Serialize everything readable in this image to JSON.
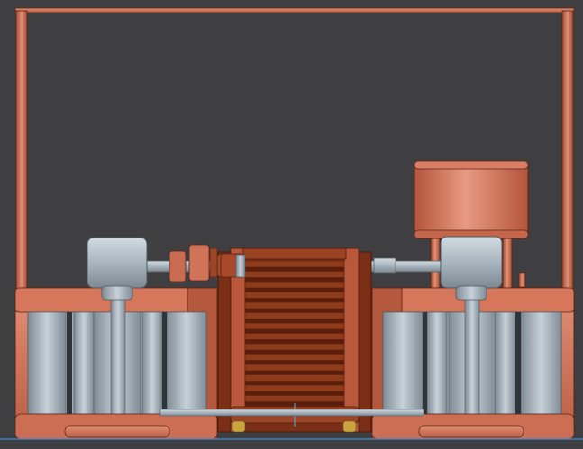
{
  "viewport": {
    "background": "#3f3f42",
    "ground_line_color": "#3d8bd6"
  },
  "model": {
    "components": [
      "top-frame-rail",
      "left-frame-post",
      "right-frame-post",
      "left-tank-assembly",
      "right-tank-assembly",
      "center-finned-core",
      "upper-shaft",
      "lower-shaft",
      "left-gear-housing",
      "right-gear-housing",
      "right-motor-housing",
      "shaft-couplings",
      "base-feet"
    ],
    "colors": {
      "copper": "#c86b50",
      "copper_light": "#e08a70",
      "copper_dark": "#8e3d28",
      "steel": "#a7b3bd",
      "steel_light": "#c6d0d8",
      "steel_dark": "#6e7a84",
      "core_rust": "#8a3a1c",
      "core_fin": "#6a2510",
      "brass": "#c8a33c",
      "edge": "#4a1a0e"
    }
  }
}
